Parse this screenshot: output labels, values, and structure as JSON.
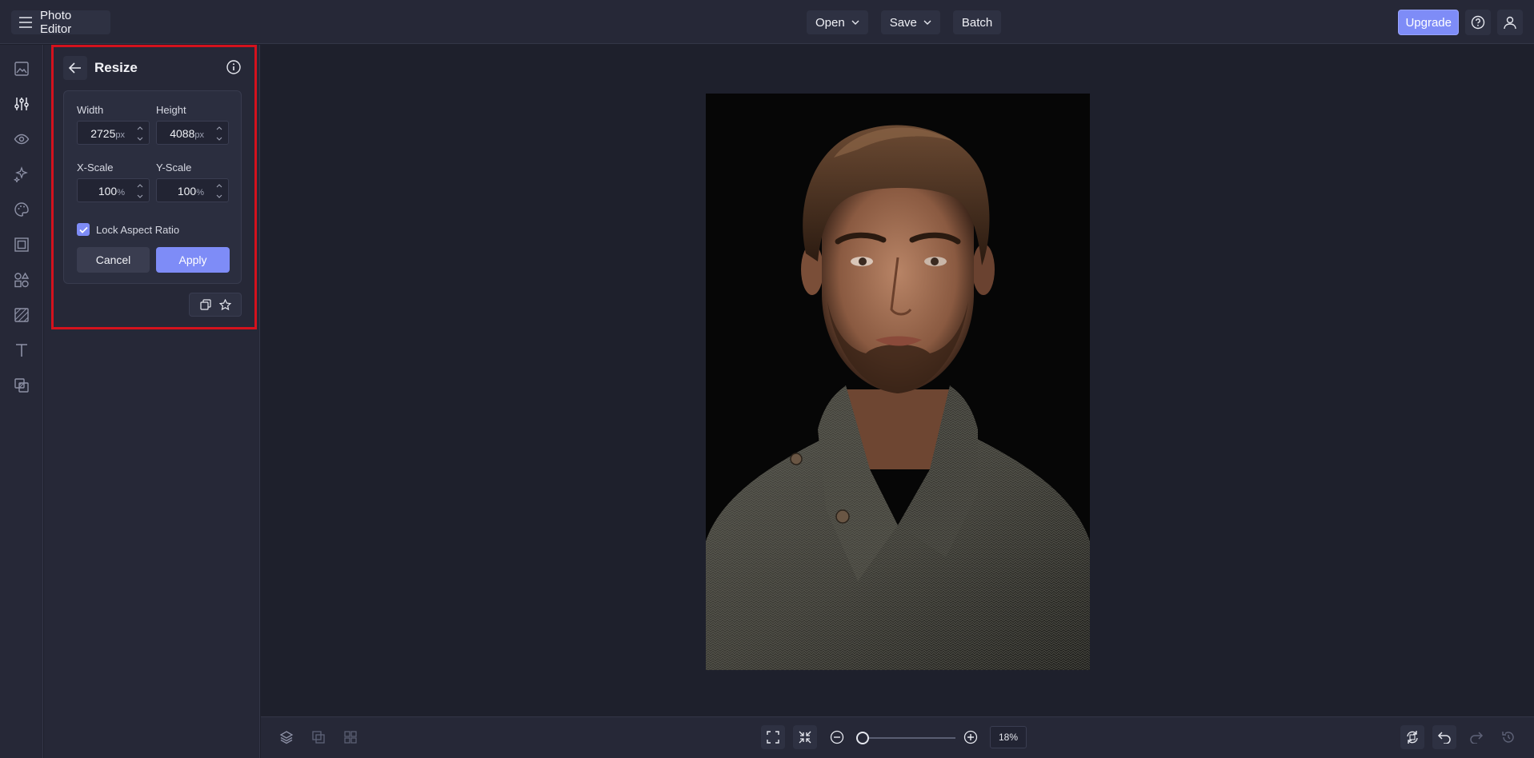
{
  "app": {
    "title": "Photo Editor",
    "accent_color": "#7e8cf7",
    "highlight_color": "#d4121d"
  },
  "topbar": {
    "menu_icon": "hamburger-icon",
    "open_label": "Open",
    "save_label": "Save",
    "batch_label": "Batch",
    "upgrade_label": "Upgrade",
    "help_icon": "help-circle-icon",
    "account_icon": "user-icon"
  },
  "rail": {
    "items": [
      {
        "name": "image-icon"
      },
      {
        "name": "adjust-sliders-icon",
        "active": true
      },
      {
        "name": "eye-icon"
      },
      {
        "name": "sparkle-effects-icon"
      },
      {
        "name": "palette-icon"
      },
      {
        "name": "frame-icon"
      },
      {
        "name": "graphics-shapes-icon"
      },
      {
        "name": "textures-icon"
      },
      {
        "name": "text-icon"
      },
      {
        "name": "overlay-icon"
      }
    ]
  },
  "panel": {
    "title": "Resize",
    "width_label": "Width",
    "width_value": "2725",
    "width_unit": "px",
    "height_label": "Height",
    "height_value": "4088",
    "height_unit": "px",
    "xscale_label": "X-Scale",
    "xscale_value": "100",
    "xscale_unit": "%",
    "yscale_label": "Y-Scale",
    "yscale_value": "100",
    "yscale_unit": "%",
    "lock_label": "Lock Aspect Ratio",
    "lock_checked": true,
    "cancel_label": "Cancel",
    "apply_label": "Apply"
  },
  "bottombar": {
    "zoom_value": "18%",
    "zoom_fraction": 0.0
  }
}
